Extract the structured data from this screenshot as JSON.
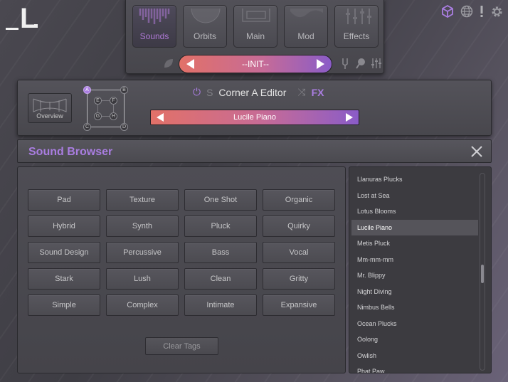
{
  "logo": {
    "text": "_L."
  },
  "top_icons": [
    "cube-icon",
    "globe-icon",
    "alert-icon",
    "gear-icon"
  ],
  "nav": {
    "tabs": [
      {
        "label": "Sounds",
        "active": true
      },
      {
        "label": "Orbits",
        "active": false
      },
      {
        "label": "Main",
        "active": false
      },
      {
        "label": "Mod",
        "active": false
      },
      {
        "label": "Effects",
        "active": false
      }
    ],
    "preset": "--INIT--"
  },
  "corner_editor": {
    "overview_label": "Overview",
    "title": "Corner A Editor",
    "solo_label": "S",
    "fx_label": "FX",
    "sound": "Lucile Piano",
    "nodes": [
      "A",
      "B",
      "C",
      "D",
      "E",
      "F",
      "G",
      "H"
    ]
  },
  "browser": {
    "title": "Sound Browser",
    "tags": [
      "Pad",
      "Texture",
      "One Shot",
      "Organic",
      "Hybrid",
      "Synth",
      "Pluck",
      "Quirky",
      "Sound Design",
      "Percussive",
      "Bass",
      "Vocal",
      "Stark",
      "Lush",
      "Clean",
      "Gritty",
      "Simple",
      "Complex",
      "Intimate",
      "Expansive"
    ],
    "clear_label": "Clear Tags",
    "sounds": [
      {
        "name": "Llanuras Plucks",
        "selected": false
      },
      {
        "name": "Lost at Sea",
        "selected": false
      },
      {
        "name": "Lotus Blooms",
        "selected": false
      },
      {
        "name": "Lucile Piano",
        "selected": true
      },
      {
        "name": "Metis Pluck",
        "selected": false
      },
      {
        "name": "Mm-mm-mm",
        "selected": false
      },
      {
        "name": "Mr. Blippy",
        "selected": false
      },
      {
        "name": "Night Diving",
        "selected": false
      },
      {
        "name": "Nimbus Bells",
        "selected": false
      },
      {
        "name": "Ocean Plucks",
        "selected": false
      },
      {
        "name": "Oolong",
        "selected": false
      },
      {
        "name": "Owlish",
        "selected": false
      },
      {
        "name": "Phat Paw",
        "selected": false
      }
    ]
  },
  "colors": {
    "accent": "#a97de0",
    "gradient_start": "#e27168",
    "gradient_end": "#8a5cc8"
  }
}
